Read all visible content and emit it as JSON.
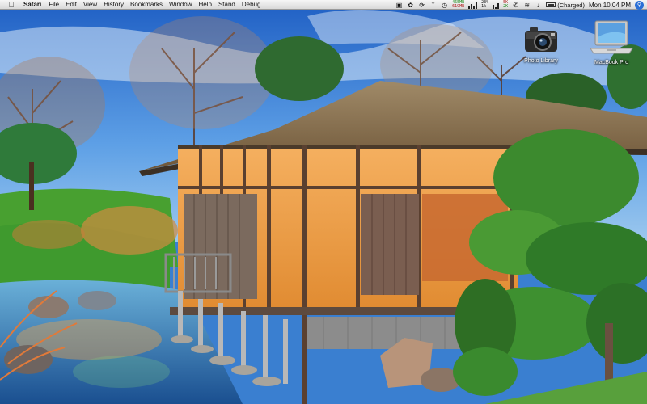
{
  "menubar": {
    "apple_icon": "apple-logo-icon",
    "app_name": "Safari",
    "menus": [
      "File",
      "Edit",
      "View",
      "History",
      "Bookmarks",
      "Window",
      "Help",
      "Stand",
      "Debug"
    ],
    "status": {
      "memory_used": "465MB",
      "memory_free": "619MB",
      "cpu_user": "23%",
      "cpu_sys": "1%",
      "net_in": "5K",
      "net_out": "2K",
      "battery": "(Charged)",
      "clock": "Mon 10:04 PM"
    }
  },
  "desktop": {
    "icons": [
      {
        "label": "Photo Library",
        "icon": "camera-icon"
      },
      {
        "label": "MacBook Pro",
        "icon": "laptop-icon"
      }
    ]
  },
  "colors": {
    "sky": "#3d7fd6",
    "roof": "#8a6f4a",
    "wall": "#f0a040",
    "grass": "#48a030",
    "water": "#2a6fb0"
  }
}
